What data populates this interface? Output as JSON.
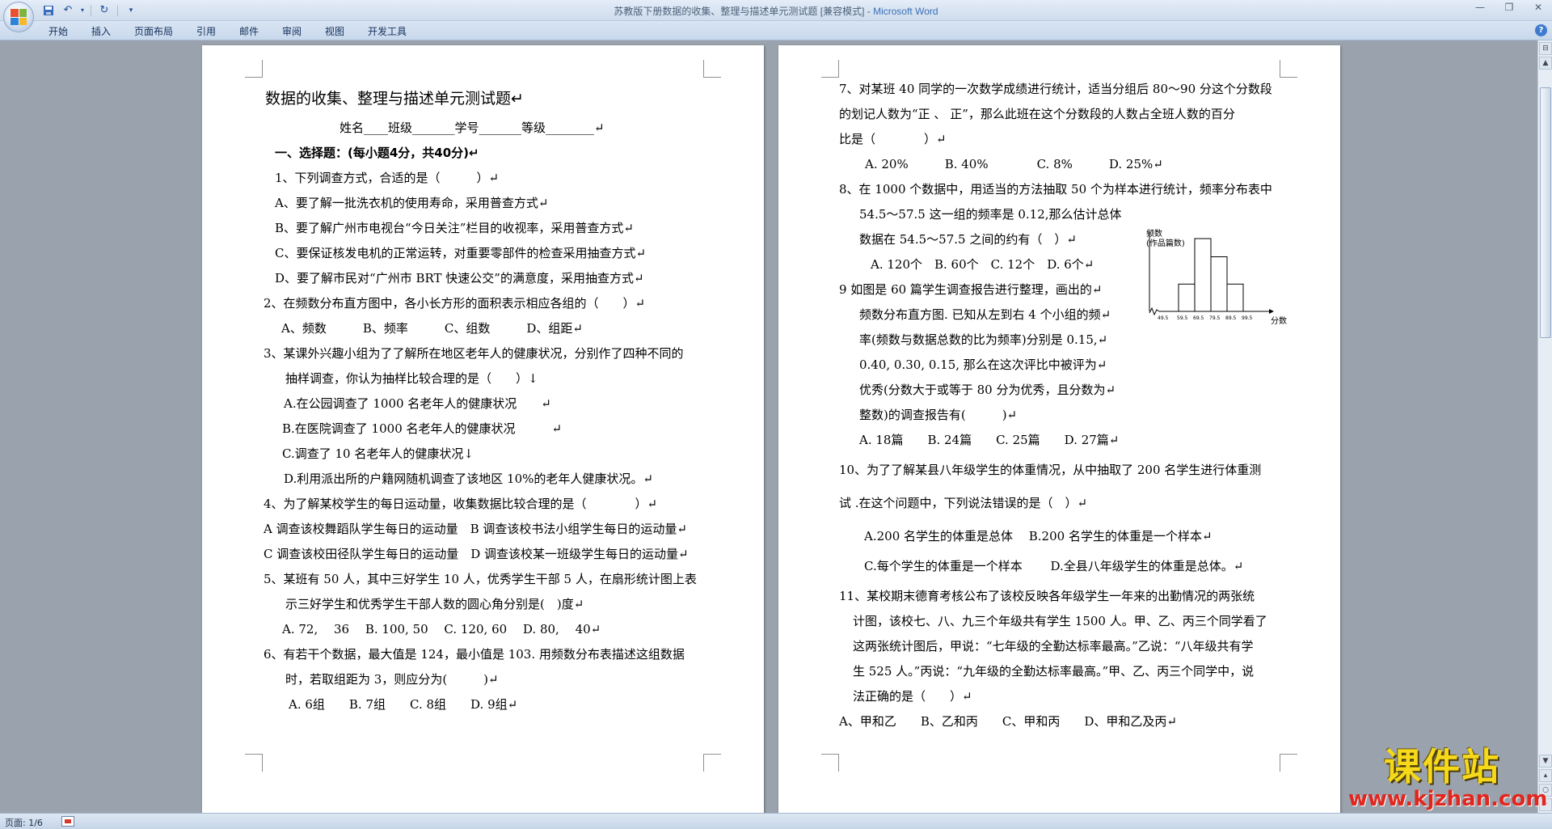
{
  "window": {
    "title": "苏教版下册数据的收集、整理与描述单元测试题 [兼容模式] - ",
    "app_name": "Microsoft Word",
    "controls": [
      "—",
      "❐",
      "✕"
    ]
  },
  "quick_access": {
    "icons": [
      "save-icon",
      "undo-icon",
      "redo-icon",
      "customize-icon"
    ]
  },
  "ribbon": {
    "tabs": [
      "开始",
      "插入",
      "页面布局",
      "引用",
      "邮件",
      "审阅",
      "视图",
      "开发工具"
    ],
    "help": "?"
  },
  "page1": {
    "lines": [
      "数据的收集、整理与描述单元测试题↵",
      "姓名____班级_______学号_______等级________↵",
      "一、选择题：(每小题4分，共40分)↵",
      "1、下列调查方式，合适的是（　　　）↵",
      "A、要了解一批洗衣机的使用寿命，采用普查方式↵",
      "B、要了解广州市电视台“今日关注”栏目的收视率，采用普查方式↵",
      "C、要保证核发电机的正常运转，对重要零部件的检查采用抽查方式↵",
      "D、要了解市民对“广州市 BRT 快速公交”的满意度，采用抽查方式↵",
      "2、在频数分布直方图中，各小长方形的面积表示相应各组的（　　）↵",
      "A、频数　　　B、频率　　　C、组数　　　D、组距↵",
      "3、某课外兴趣小组为了了解所在地区老年人的健康状况，分别作了四种不同的",
      "抽样调查，你认为抽样比较合理的是（　　）↓",
      "A.在公园调查了 1000 名老年人的健康状况　　↵",
      "B.在医院调查了 1000 名老年人的健康状况　　　↵",
      "C.调查了 10 名老年人的健康状况↓",
      "D.利用派出所的户籍网随机调查了该地区 10%的老年人健康状况。↵",
      "4、为了解某校学生的每日运动量，收集数据比较合理的是（　　　　）↵",
      "A 调查该校舞蹈队学生每日的运动量　B 调查该校书法小组学生每日的运动量↵",
      "C 调查该校田径队学生每日的运动量　D 调查该校某一班级学生每日的运动量↵",
      "5、某班有 50 人，其中三好学生 10 人，优秀学生干部 5 人，在扇形统计图上表",
      "示三好学生和优秀学生干部人数的圆心角分别是(　)度↵",
      "A.  72,　 36　 B.  100,  50　 C.  120,  60　 D.  80,　 40↵",
      "6、有若干个数据，最大值是 124，最小值是 103.  用频数分布表描述这组数据",
      "时，若取组距为 3，则应分为(　　　)↵",
      "A. 6组　　B. 7组　　C. 8组　　D. 9组↵"
    ]
  },
  "page2": {
    "lines": [
      "7、对某班 40 同学的一次数学成绩进行统计，适当分组后 80～90 分这个分数段",
      "的划记人数为“正 、 正”，那么此班在这个分数段的人数占全班人数的百分",
      "比是（　　　　）↵",
      "A. 20%　　　B. 40%　　　　C. 8%　　　D. 25%↵",
      "8、在 1000 个数据中，用适当的方法抽取 50 个为样本进行统计，频率分布表中",
      "54.5～57.5 这一组的频率是 0.12,那么估计总体",
      "数据在 54.5～57.5 之间的约有（　）↵",
      "A. 120个　B. 60个　C. 12个　D. 6个↵",
      "9 如图是 60 篇学生调查报告进行整理，画出的↵",
      "频数分布直方图. 已知从左到右 4 个小组的频↵",
      "率(频数与数据总数的比为频率)分别是 0.15,↵",
      "0.40, 0.30, 0.15, 那么在这次评比中被评为↵",
      "优秀(分数大于或等于 80 分为优秀，且分数为↵",
      "整数)的调查报告有(　　　)↵",
      "A. 18篇　　B. 24篇　　C. 25篇　　D. 27篇↵",
      "10、为了了解某县八年级学生的体重情况，从中抽取了 200 名学生进行体重测",
      "试 .在这个问题中，下列说法错误的是（　）↵",
      "A.200 名学生的体重是总体　 B.200 名学生的体重是一个样本↵",
      "C.每个学生的体重是一个样本　　 D.全县八年级学生的体重是总体。↵",
      "11、某校期末德育考核公布了该校反映各年级学生一年来的出勤情况的两张统",
      "计图，该校七、八、九三个年级共有学生 1500 人。甲、乙、丙三个同学看了",
      "这两张统计图后，甲说：“七年级的全勤达标率最高。”乙说：“八年级共有学",
      "生 525 人。”丙说：“九年级的全勤达标率最高。”甲、乙、丙三个同学中，说",
      "法正确的是（　　）↵",
      "A、甲和乙　　B、乙和丙　　C、甲和丙　　D、甲和乙及丙↵"
    ],
    "histogram": {
      "ylabel": "频数",
      "ylabel2": "(作品篇数)",
      "xlabel": "分数",
      "ticks": [
        "49.5",
        "59.5",
        "69.5",
        "79.5",
        "89.5",
        "99.5"
      ],
      "frequencies": [
        0.15,
        0.4,
        0.3,
        0.15
      ]
    }
  },
  "statusbar": {
    "page": "页面: 1/6"
  },
  "watermark": {
    "cn": "课件站",
    "url": "www.kjzhan.com"
  }
}
